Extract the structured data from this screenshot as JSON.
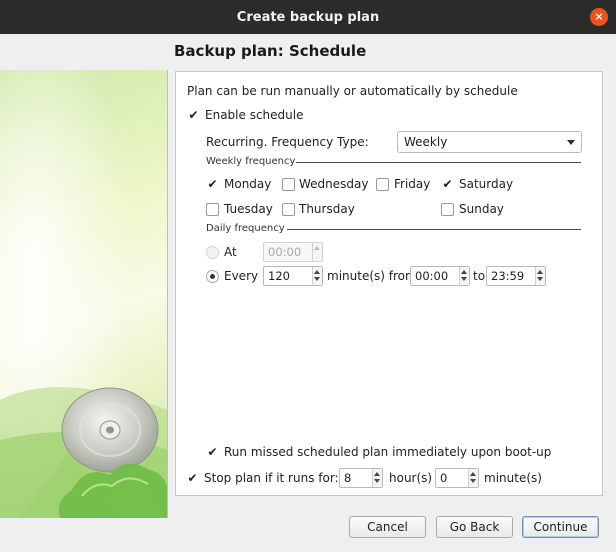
{
  "window": {
    "title": "Create backup plan",
    "close_glyph": "×"
  },
  "page": {
    "heading": "Backup plan: Schedule"
  },
  "schedule": {
    "description": "Plan can be run manually or automatically by schedule",
    "enable_label": "Enable schedule",
    "enable_checked": true,
    "frequency_type_label": "Recurring. Frequency Type:",
    "frequency_type_value": "Weekly",
    "weekly_group_label": "Weekly frequency",
    "days": [
      {
        "label": "Monday",
        "checked": true
      },
      {
        "label": "Wednesday",
        "checked": false
      },
      {
        "label": "Friday",
        "checked": false
      },
      {
        "label": "Saturday",
        "checked": true
      },
      {
        "label": "Tuesday",
        "checked": false
      },
      {
        "label": "Thursday",
        "checked": false
      },
      {
        "label": "Sunday",
        "checked": false
      }
    ],
    "daily_group_label": "Daily frequency",
    "at_label": "At",
    "at_value": "00:00",
    "at_selected": false,
    "every_label": "Every",
    "every_selected": true,
    "every_value": "120",
    "minutes_from_label": "minute(s) from",
    "from_value": "00:00",
    "to_label": "to",
    "to_value": "23:59",
    "missed_label": "Run missed scheduled plan immediately upon boot-up",
    "missed_checked": true
  },
  "stop": {
    "label": "Stop plan if it runs for:",
    "checked": true,
    "hours_value": "8",
    "hours_label": "hour(s)",
    "minutes_value": "0",
    "minutes_label": "minute(s)"
  },
  "buttons": {
    "cancel": "Cancel",
    "back": "Go Back",
    "continue": "Continue"
  },
  "check_glyph": "✔",
  "colors": {
    "titlebar": "#2b2b2b",
    "close": "#e95420",
    "panel": "#ffffff",
    "background": "#efefef"
  }
}
